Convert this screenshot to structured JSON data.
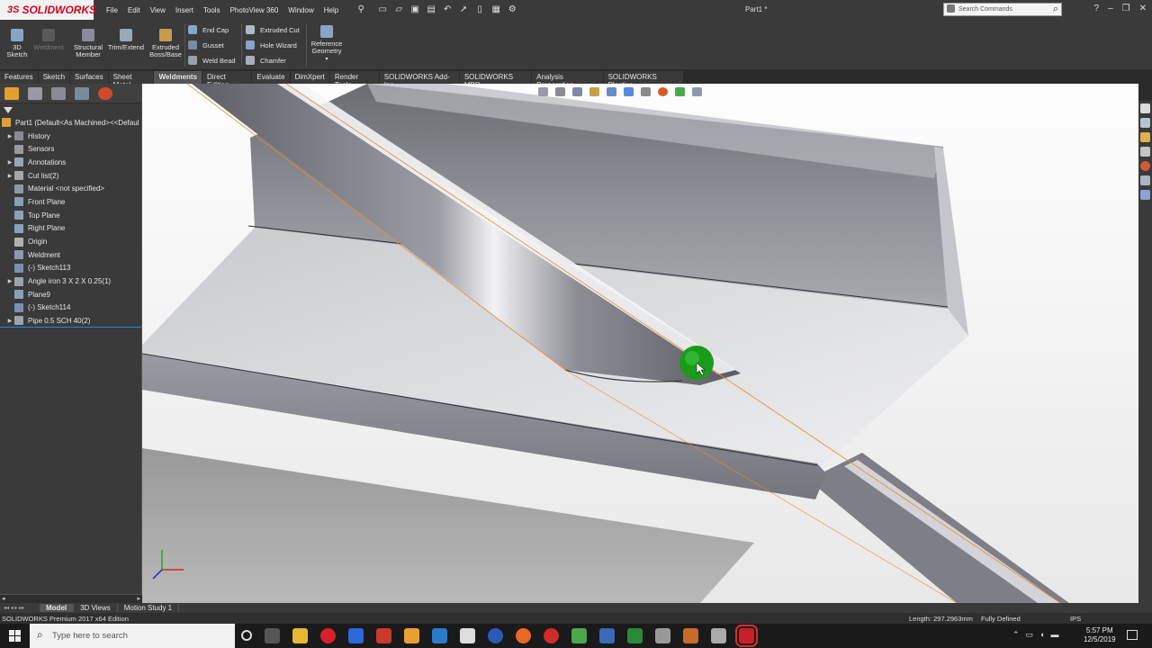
{
  "app": {
    "brand": "SOLIDWORKS",
    "brand_mark": "3S",
    "document_title": "Part1 *"
  },
  "menu": [
    "File",
    "Edit",
    "View",
    "Insert",
    "Tools",
    "PhotoView 360",
    "Window",
    "Help"
  ],
  "search": {
    "placeholder": "Search Commands"
  },
  "commands": {
    "sketch3d": "3D\nSketch",
    "weldment": "Weldment",
    "structural_member": "Structural\nMember",
    "trim_extend": "Trim/Extend",
    "extruded_boss": "Extruded\nBoss/Base",
    "end_cap": "End Cap",
    "gusset": "Gusset",
    "weld_bead": "Weld Bead",
    "extruded_cut": "Extruded Cut",
    "hole_wizard": "Hole Wizard",
    "chamfer": "Chamfer",
    "reference_geometry": "Reference\nGeometry"
  },
  "tabs": [
    {
      "label": "Features",
      "active": false
    },
    {
      "label": "Sketch",
      "active": false
    },
    {
      "label": "Surfaces",
      "active": false
    },
    {
      "label": "Sheet Metal",
      "active": false
    },
    {
      "label": "Weldments",
      "active": true
    },
    {
      "label": "Direct Editing",
      "active": false
    },
    {
      "label": "Evaluate",
      "active": false
    },
    {
      "label": "DimXpert",
      "active": false
    },
    {
      "label": "Render Tools",
      "active": false
    },
    {
      "label": "SOLIDWORKS Add-Ins",
      "active": false
    },
    {
      "label": "SOLIDWORKS MBD",
      "active": false
    },
    {
      "label": "Analysis Preparation",
      "active": false
    },
    {
      "label": "SOLIDWORKS Plastics",
      "active": false
    }
  ],
  "feature_tree": {
    "root": "Part1  (Default<As Machined><<Defaul",
    "items": [
      {
        "label": "History",
        "expandable": true,
        "icon": "history-icon"
      },
      {
        "label": "Sensors",
        "expandable": false,
        "icon": "sensor-icon"
      },
      {
        "label": "Annotations",
        "expandable": true,
        "icon": "annotation-icon"
      },
      {
        "label": "Cut list(2)",
        "expandable": true,
        "icon": "cut-list-icon"
      },
      {
        "label": "Material <not specified>",
        "expandable": false,
        "icon": "material-icon"
      },
      {
        "label": "Front Plane",
        "expandable": false,
        "icon": "plane-icon"
      },
      {
        "label": "Top Plane",
        "expandable": false,
        "icon": "plane-icon"
      },
      {
        "label": "Right Plane",
        "expandable": false,
        "icon": "plane-icon"
      },
      {
        "label": "Origin",
        "expandable": false,
        "icon": "origin-icon"
      },
      {
        "label": "Weldment",
        "expandable": false,
        "icon": "weldment-icon"
      },
      {
        "label": "(-) Sketch113",
        "expandable": false,
        "icon": "sketch-icon"
      },
      {
        "label": "Angle iron 3 X 2 X 0.25(1)",
        "expandable": true,
        "icon": "structural-member-icon"
      },
      {
        "label": "Plane9",
        "expandable": false,
        "icon": "plane-icon"
      },
      {
        "label": "(-) Sketch114",
        "expandable": false,
        "icon": "sketch-icon"
      },
      {
        "label": "Pipe 0.5 SCH 40(2)",
        "expandable": true,
        "icon": "structural-member-icon",
        "selected": true
      }
    ]
  },
  "bottom_tabs": [
    {
      "label": "Model",
      "active": true
    },
    {
      "label": "3D Views",
      "active": false
    },
    {
      "label": "Motion Study 1",
      "active": false
    }
  ],
  "status": {
    "edition": "SOLIDWORKS Premium 2017 x64 Edition",
    "length": "Length: 297.2963mm",
    "defined": "Fully Defined",
    "units": "IPS"
  },
  "taskbar": {
    "search_placeholder": "Type here to search",
    "time": "5:57 PM",
    "date": "12/5/2019"
  },
  "colors": {
    "ui_dark": "#3a3a3a",
    "brand_red": "#d9001b",
    "selection_green": "#1a9c1a",
    "edge_orange": "#e88a2a"
  }
}
